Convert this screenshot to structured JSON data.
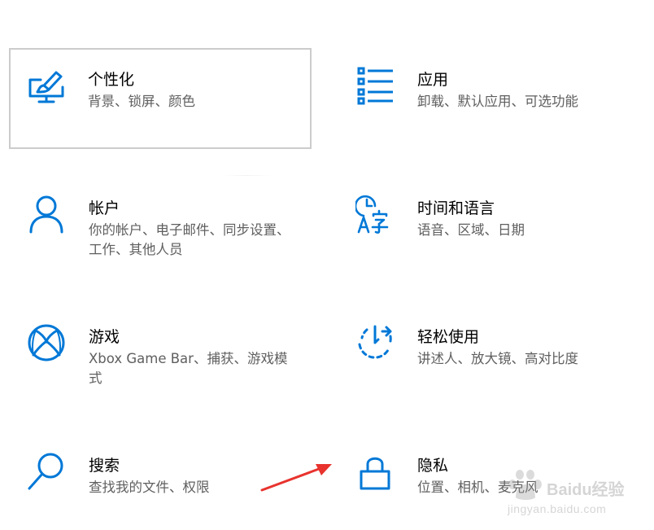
{
  "settings_tiles": [
    {
      "title": "个性化",
      "description": "背景、锁屏、颜色",
      "icon": "personalization-icon"
    },
    {
      "title": "应用",
      "description": "卸载、默认应用、可选功能",
      "icon": "apps-icon"
    },
    {
      "title": "帐户",
      "description": "你的帐户、电子邮件、同步设置、工作、其他人员",
      "icon": "accounts-icon"
    },
    {
      "title": "时间和语言",
      "description": "语音、区域、日期",
      "icon": "time-language-icon"
    },
    {
      "title": "游戏",
      "description": "Xbox Game Bar、捕获、游戏模式",
      "icon": "gaming-icon"
    },
    {
      "title": "轻松使用",
      "description": "讲述人、放大镜、高对比度",
      "icon": "ease-of-access-icon"
    },
    {
      "title": "搜索",
      "description": "查找我的文件、权限",
      "icon": "search-icon"
    },
    {
      "title": "隐私",
      "description": "位置、相机、麦克风",
      "icon": "privacy-lock-icon"
    }
  ],
  "watermark": {
    "text": "Baidu经验",
    "url": "jingyan.baidu.com"
  },
  "colors": {
    "accent": "#0078d7",
    "title_text": "#000000",
    "description_text": "#5f5f5f",
    "arrow": "#e8332e",
    "hover_border": "#cccccc"
  }
}
